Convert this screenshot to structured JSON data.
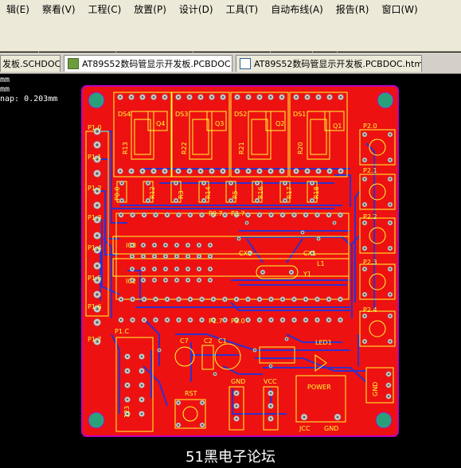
{
  "menu": {
    "items": [
      "辑(E)",
      "察看(V)",
      "工程(C)",
      "放置(P)",
      "设计(D)",
      "工具(T)",
      "自动布线(A)",
      "报告(R)",
      "窗口(W)"
    ]
  },
  "tabs": [
    {
      "label": "发板.SCHDOC",
      "type": "sch"
    },
    {
      "label": "AT89S52数码管显示开发板.PCBDOC",
      "type": "pcb"
    },
    {
      "label": "AT89S52数码管显示开发板.PCBDOC.htm",
      "type": "html"
    }
  ],
  "info": {
    "line1": "mm",
    "line2": "mm",
    "line3": "nap: 0.203mm"
  },
  "pcb": {
    "colors": {
      "board": "#ee1111",
      "outline": "#c000c0",
      "silk": "#ffff33",
      "bottom_trace": "#3030cc",
      "pad": "#c8c8c8",
      "hole": "#2aa07a"
    },
    "digits": [
      "DS4",
      "DS3",
      "DS2",
      "DS1"
    ],
    "transistors": [
      "Q4",
      "Q3",
      "Q2",
      "Q1"
    ],
    "digit_resistors": [
      "R13",
      "R22",
      "R21",
      "R20"
    ],
    "resistors": [
      "P0.0",
      "R12",
      "R3",
      "R14",
      "R5",
      "R16",
      "R17",
      "R18"
    ],
    "left_header": [
      "P1.0",
      "P1.1",
      "P1.2",
      "P1.3",
      "P1.4",
      "P1.5",
      "P1.6",
      "P1.7"
    ],
    "right_buttons": [
      "P2.0",
      "P2.1",
      "P2.2",
      "P2.3",
      "P2.4"
    ],
    "labels": {
      "p07": "P0.7",
      "p27": "P2.7",
      "ic3": "IC3",
      "ic2": "IC2",
      "cx2": "CX2",
      "cx1": "CX1",
      "y1": "Y1",
      "l1": "L1",
      "p17": "P1.7",
      "p30": "P3.0",
      "p1c": "P1.C",
      "c7": "C7",
      "c2": "C2",
      "c1": "C1",
      "led1": "LED1",
      "rst": "RST",
      "gnd": "GND",
      "vcc": "VCC",
      "power": "POWER",
      "jcc": "JCC",
      "gnd2": "GND",
      "gnd3": "GND",
      "nums": "123"
    }
  },
  "caption": "51黑电子论坛"
}
